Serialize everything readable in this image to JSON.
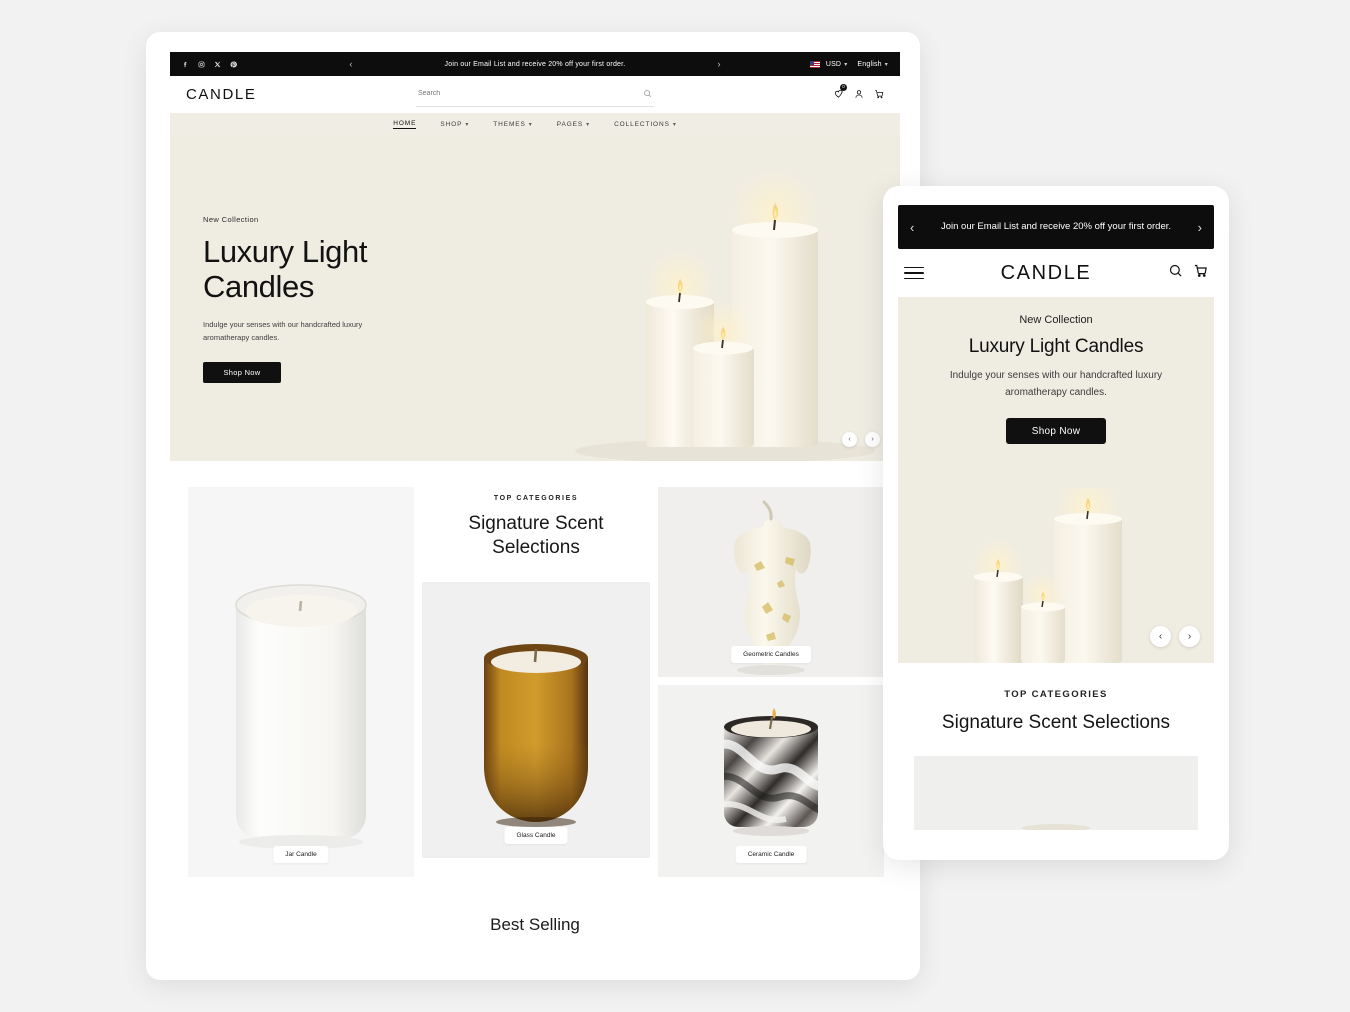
{
  "colors": {
    "announcement_bg": "#0d0d0d",
    "hero_bg": "#efece2",
    "nav_bg": "#f0ede4",
    "page_bg": "#f2f2f2",
    "tile_bg": "#f0f0f0",
    "accent_dark": "#101010"
  },
  "desktop": {
    "announcement": {
      "socials": [
        "facebook-icon",
        "instagram-icon",
        "x-icon",
        "pinterest-icon"
      ],
      "prev": "‹",
      "next": "›",
      "message": "Join our Email List and receive 20% off your first order.",
      "currency": "USD",
      "language": "English",
      "chevron": "⌄"
    },
    "header": {
      "logo": "CANDLE",
      "search_placeholder": "Search",
      "search_value": "",
      "wishlist_count": "0"
    },
    "nav": [
      {
        "label": "HOME",
        "has_chevron": false,
        "active": true
      },
      {
        "label": "SHOP",
        "has_chevron": true,
        "active": false
      },
      {
        "label": "THEMES",
        "has_chevron": true,
        "active": false
      },
      {
        "label": "PAGES",
        "has_chevron": true,
        "active": false
      },
      {
        "label": "COLLECTIONS",
        "has_chevron": true,
        "active": false
      }
    ],
    "hero": {
      "eyebrow": "New Collection",
      "title_line1": "Luxury Light",
      "title_line2": "Candles",
      "subtitle": "Indulge your senses with our handcrafted luxury aromatherapy candles.",
      "cta": "Shop Now",
      "prev": "‹",
      "next": "›"
    },
    "categories": {
      "eyebrow": "TOP CATEGORIES",
      "title_line1": "Signature Scent",
      "title_line2": "Selections",
      "items": [
        {
          "label": "Jar Candle"
        },
        {
          "label": "Glass Candle"
        },
        {
          "label": "Geometric Candles"
        },
        {
          "label": "Ceramic Candle"
        }
      ]
    },
    "best_selling": {
      "title": "Best Selling"
    }
  },
  "mobile": {
    "announcement": {
      "message": "Join our Email List and receive 20% off your first order.",
      "prev": "‹",
      "next": "›"
    },
    "header": {
      "logo": "CANDLE"
    },
    "hero": {
      "eyebrow": "New Collection",
      "title": "Luxury Light Candles",
      "subtitle": "Indulge your senses with our handcrafted luxury aromatherapy candles.",
      "cta": "Shop Now",
      "prev": "‹",
      "next": "›"
    },
    "categories": {
      "eyebrow": "TOP CATEGORIES",
      "title": "Signature Scent Selections"
    }
  }
}
